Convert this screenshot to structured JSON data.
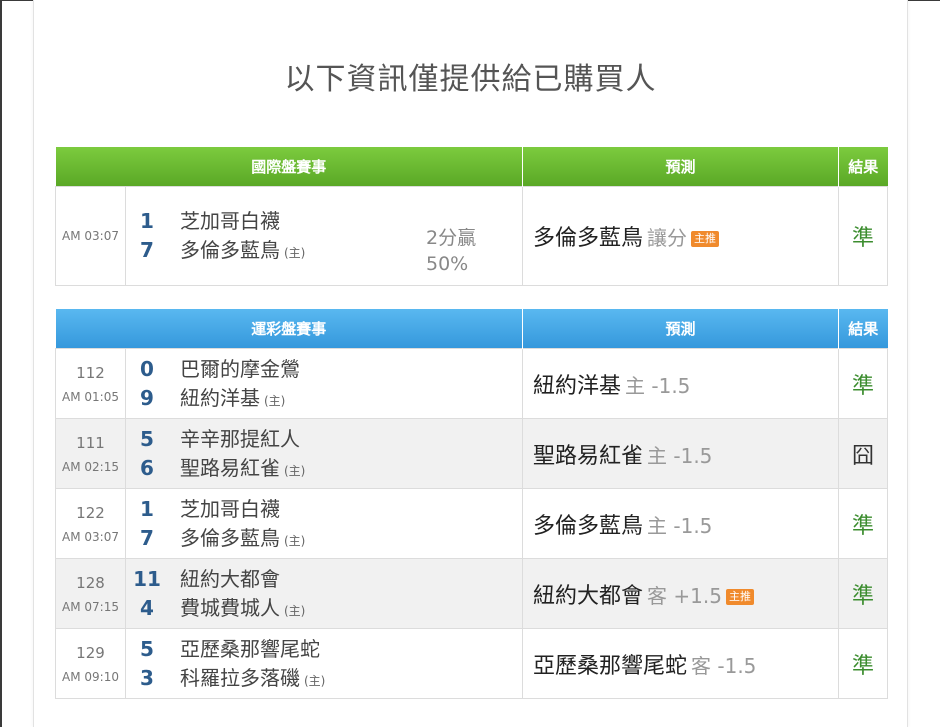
{
  "page": {
    "title": "以下資訊僅提供給已購買人"
  },
  "intl": {
    "headers": {
      "match": "國際盤賽事",
      "prediction": "預測",
      "result": "結果"
    },
    "row": {
      "time": "AM 03:07",
      "away_score": "1",
      "away_team": "芝加哥白襪",
      "home_score": "7",
      "home_team": "多倫多藍鳥",
      "home_mark": "(主)",
      "handicap_line1": "2分贏",
      "handicap_line2": "50%",
      "pred_team": "多倫多藍鳥",
      "pred_side": "讓分",
      "badge": "主推",
      "result": "準"
    }
  },
  "sports": {
    "headers": {
      "match": "運彩盤賽事",
      "prediction": "預測",
      "result": "結果"
    },
    "rows": [
      {
        "no": "112",
        "time": "AM 01:05",
        "away_score": "0",
        "away_team": "巴爾的摩金鶯",
        "home_score": "9",
        "home_team": "紐約洋基",
        "home_mark": "(主)",
        "pred_team": "紐約洋基",
        "pred_side": "主 -1.5",
        "badge": "",
        "result": "準"
      },
      {
        "no": "111",
        "time": "AM 02:15",
        "away_score": "5",
        "away_team": "辛辛那提紅人",
        "home_score": "6",
        "home_team": "聖路易紅雀",
        "home_mark": "(主)",
        "pred_team": "聖路易紅雀",
        "pred_side": "主 -1.5",
        "badge": "",
        "result": "囧"
      },
      {
        "no": "122",
        "time": "AM 03:07",
        "away_score": "1",
        "away_team": "芝加哥白襪",
        "home_score": "7",
        "home_team": "多倫多藍鳥",
        "home_mark": "(主)",
        "pred_team": "多倫多藍鳥",
        "pred_side": "主 -1.5",
        "badge": "",
        "result": "準"
      },
      {
        "no": "128",
        "time": "AM 07:15",
        "away_score": "11",
        "away_team": "紐約大都會",
        "home_score": "4",
        "home_team": "費城費城人",
        "home_mark": "(主)",
        "pred_team": "紐約大都會",
        "pred_side": "客 +1.5",
        "badge": "主推",
        "result": "準"
      },
      {
        "no": "129",
        "time": "AM 09:10",
        "away_score": "5",
        "away_team": "亞歷桑那響尾蛇",
        "home_score": "3",
        "home_team": "科羅拉多落磯",
        "home_mark": "(主)",
        "pred_team": "亞歷桑那響尾蛇",
        "pred_side": "客 -1.5",
        "badge": "",
        "result": "準"
      }
    ]
  },
  "colors": {
    "intl_header": "#6ab931",
    "sports_header": "#45a6e6",
    "win": "#3c8d2f",
    "badge": "#f08a2c",
    "score": "#2d5c8c"
  }
}
